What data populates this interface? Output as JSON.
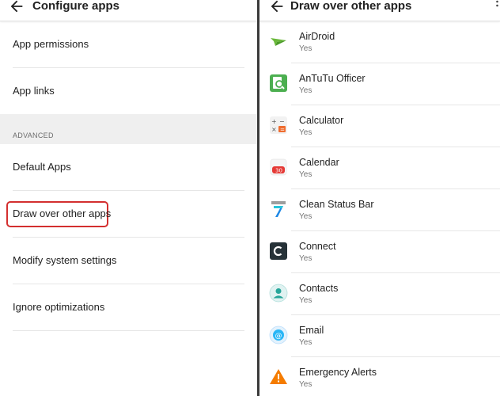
{
  "left": {
    "title": "Configure apps",
    "items_top": [
      {
        "label": "App permissions"
      },
      {
        "label": "App links"
      }
    ],
    "section": "ADVANCED",
    "items_bottom": [
      {
        "label": "Default Apps"
      },
      {
        "label": "Draw over other apps"
      },
      {
        "label": "Modify system settings"
      },
      {
        "label": "Ignore optimizations"
      }
    ]
  },
  "right": {
    "title": "Draw over other apps",
    "apps": [
      {
        "name": "AirDroid",
        "status": "Yes",
        "icon": "airdroid-icon"
      },
      {
        "name": "AnTuTu Officer",
        "status": "Yes",
        "icon": "antutu-icon"
      },
      {
        "name": "Calculator",
        "status": "Yes",
        "icon": "calculator-icon"
      },
      {
        "name": "Calendar",
        "status": "Yes",
        "icon": "calendar-icon",
        "icon_text": "30"
      },
      {
        "name": "Clean Status Bar",
        "status": "Yes",
        "icon": "clean-status-bar-icon"
      },
      {
        "name": "Connect",
        "status": "Yes",
        "icon": "connect-icon"
      },
      {
        "name": "Contacts",
        "status": "Yes",
        "icon": "contacts-icon"
      },
      {
        "name": "Email",
        "status": "Yes",
        "icon": "email-icon"
      },
      {
        "name": "Emergency Alerts",
        "status": "Yes",
        "icon": "emergency-alerts-icon"
      }
    ]
  },
  "colors": {
    "highlight": "#d32f2f",
    "divider": "#3a3a3a",
    "section_bg": "#efefef"
  }
}
